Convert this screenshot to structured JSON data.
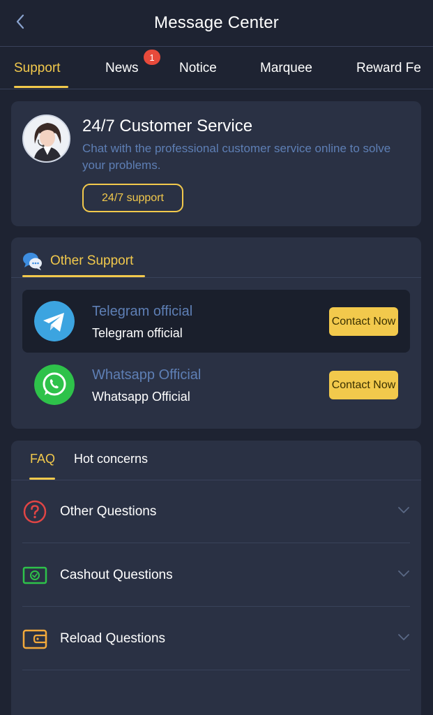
{
  "header": {
    "title": "Message Center"
  },
  "tabs": [
    {
      "label": "Support",
      "active": true
    },
    {
      "label": "News",
      "badge": "1"
    },
    {
      "label": "Notice"
    },
    {
      "label": "Marquee"
    },
    {
      "label": "Reward Fe"
    }
  ],
  "customer_service": {
    "title": "24/7 Customer Service",
    "description": "Chat with the professional customer service online to solve your problems.",
    "button_label": "24/7 support"
  },
  "other_support": {
    "title": "Other Support",
    "contacts": [
      {
        "name": "Telegram official",
        "subtitle": "Telegram official",
        "button_label": "Contact Now",
        "icon": "telegram-icon"
      },
      {
        "name": "Whatsapp Official",
        "subtitle": "Whatsapp Official",
        "button_label": "Contact Now",
        "icon": "whatsapp-icon"
      }
    ]
  },
  "faq": {
    "tabs": [
      {
        "label": "FAQ",
        "active": true
      },
      {
        "label": "Hot concerns"
      }
    ],
    "items": [
      {
        "label": "Other Questions",
        "icon": "question-icon"
      },
      {
        "label": "Cashout Questions",
        "icon": "cash-icon"
      },
      {
        "label": "Reload Questions",
        "icon": "wallet-icon"
      }
    ]
  },
  "colors": {
    "background": "#1e2332",
    "card": "#2a3144",
    "accent": "#f2c94c",
    "link_blue": "#5e7fb5",
    "badge_red": "#e84a3b"
  }
}
